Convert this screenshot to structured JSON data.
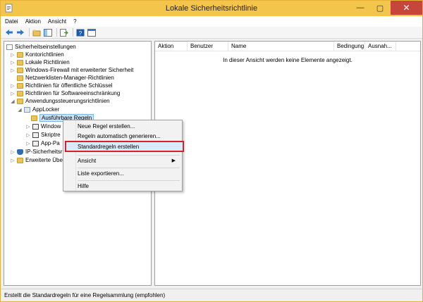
{
  "window": {
    "title": "Lokale Sicherheitsrichtlinie"
  },
  "window_controls": {
    "minimize": "—",
    "maximize": "▢",
    "close": "✕"
  },
  "menubar": {
    "items": [
      "Datei",
      "Aktion",
      "Ansicht",
      "?"
    ]
  },
  "toolbar": {
    "icons": [
      "back-arrow-icon",
      "forward-arrow-icon",
      "folder-up-icon",
      "view-pane-icon",
      "export-list-icon",
      "help-icon",
      "console-icon"
    ]
  },
  "tree": {
    "root": "Sicherheitseinstellungen",
    "items": [
      "Kontorichtlinien",
      "Lokale Richtlinien",
      "Windows-Firewall mit erweiterter Sicherheit",
      "Netzwerklisten-Manager-Richtlinien",
      "Richtlinien für öffentliche Schlüssel",
      "Richtlinien für Softwareeinschränkung",
      "Anwendungssteuerungsrichtlinien"
    ],
    "applocker": "AppLocker",
    "applocker_children": [
      "Ausführbare Regeln",
      "Window",
      "Skriptre",
      "App-Pa"
    ],
    "after": [
      "IP-Sicherheitsri",
      "Erweiterte Über"
    ]
  },
  "list": {
    "columns": [
      "Aktion",
      "Benutzer",
      "Name",
      "Bedingung",
      "Ausnah..."
    ],
    "empty_message": "In dieser Ansicht werden keine Elemente angezeigt."
  },
  "context_menu": {
    "items": [
      "Neue Regel erstellen...",
      "Regeln automatisch generieren...",
      "Standardregeln erstellen",
      "Ansicht",
      "Liste exportieren...",
      "Hilfe"
    ],
    "submenu_arrow": "▶"
  },
  "statusbar": {
    "text": "Erstellt die Standardregeln für eine Regelsammlung (empfohlen)"
  },
  "colors": {
    "titlebar": "#f3c64b",
    "close": "#c7463c",
    "highlight_border": "#d8202a",
    "selection": "#cce4f7"
  }
}
